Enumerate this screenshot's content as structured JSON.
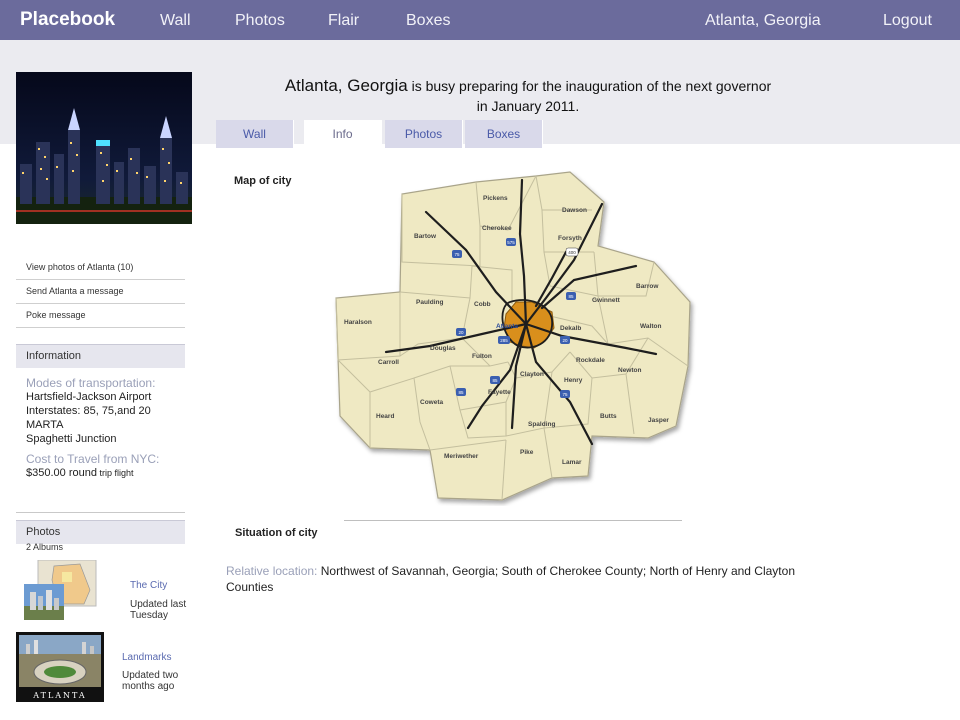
{
  "topbar": {
    "brand": "Placebook",
    "nav": [
      "Wall",
      "Photos",
      "Flair",
      "Boxes"
    ],
    "location": "Atlanta, Georgia",
    "logout": "Logout"
  },
  "headline": {
    "city": "Atlanta, Georgia",
    "text1": " is busy preparing for the inauguration of the next governor",
    "text2": "in January 2011."
  },
  "tabs": [
    "Wall",
    "Info",
    "Photos",
    "Boxes"
  ],
  "active_tab": "Info",
  "sidebar": {
    "links": [
      "View photos of Atlanta (10)",
      "Send Atlanta a message",
      "Poke message"
    ],
    "info_heading": "Information",
    "transport_label": "Modes of transportation:",
    "transport_items": [
      "Hartsfield-Jackson Airport",
      "Interstates:  85, 75,and 20",
      "MARTA",
      "Spaghetti Junction"
    ],
    "cost_label": "Cost to Travel  from NYC:",
    "cost_value": "$350.00 round",
    "cost_suffix": " trip flight",
    "photos_heading": "Photos",
    "photos_sub": "2 Albums",
    "albums": [
      {
        "title": "The City",
        "updated": "Updated last Tuesday"
      },
      {
        "title": "Landmarks",
        "updated": "Updated two months ago"
      }
    ],
    "landmarks_thumb_text": "ATLANTA"
  },
  "map": {
    "label": "Map of city",
    "counties": [
      "Pickens",
      "Dawson",
      "Bartow",
      "Cherokee",
      "Forsyth",
      "Barrow",
      "Gwinnett",
      "Paulding",
      "Cobb",
      "Haralson",
      "Walton",
      "Dekalb",
      "Atlanta",
      "Douglas",
      "Fulton",
      "Carroll",
      "Rockdale",
      "Newton",
      "Clayton",
      "Henry",
      "Coweta",
      "Fayette",
      "Heard",
      "Butts",
      "Spalding",
      "Jasper",
      "Meriwether",
      "Pike",
      "Lamar"
    ],
    "shield_numbers": [
      "75",
      "575",
      "400",
      "85",
      "20",
      "285",
      "20",
      "85",
      "75",
      "85"
    ]
  },
  "situation": {
    "label": "Situation of city",
    "rel_label": "Relative location:",
    "rel_text": "  Northwest of Savannah, Georgia;  South of Cherokee County; North of Henry and Clayton Counties"
  },
  "colors": {
    "topbar": "#6b6b9c",
    "band": "#ebebf0",
    "county_fill": "#efe9c3",
    "metro_fill": "#d98f1c",
    "tab_inactive": "#d9d9ea",
    "link_blue": "#5a6ab0"
  }
}
